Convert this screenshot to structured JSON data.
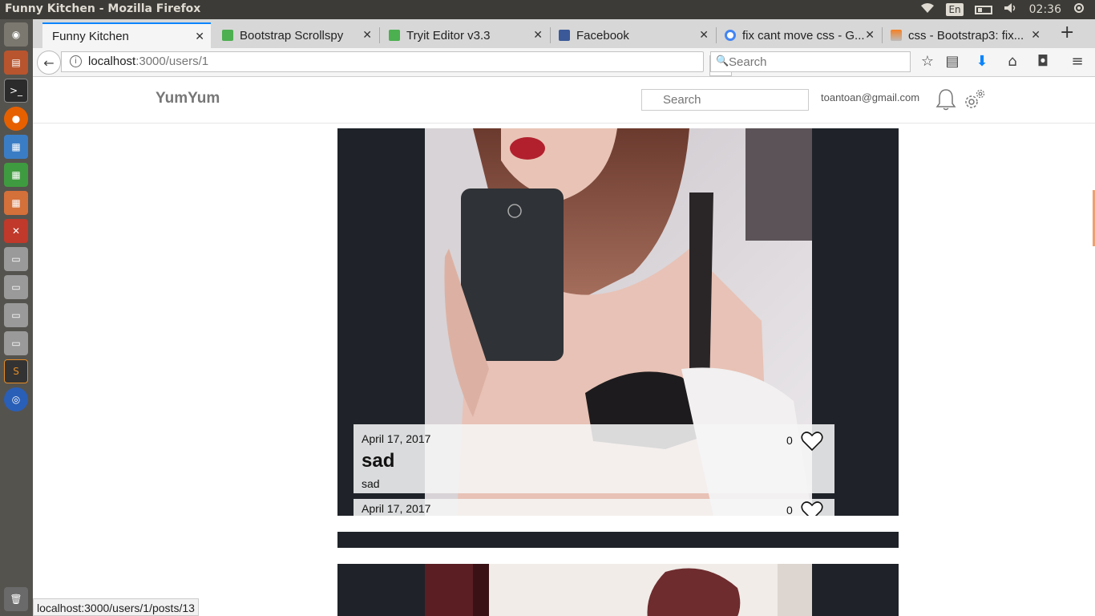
{
  "os": {
    "window_title": "Funny Kitchen - Mozilla Firefox",
    "keyboard_layout": "En",
    "clock": "02:36"
  },
  "browser": {
    "tabs": [
      {
        "label": "Funny Kitchen",
        "icon": "none",
        "active": true
      },
      {
        "label": "Bootstrap Scrollspy",
        "icon": "w3-icon",
        "active": false
      },
      {
        "label": "Tryit Editor v3.3",
        "icon": "w3-icon",
        "active": false
      },
      {
        "label": "Facebook",
        "icon": "facebook-icon",
        "active": false
      },
      {
        "label": "fix cant move css - G...",
        "icon": "google-icon",
        "active": false
      },
      {
        "label": "css - Bootstrap3: fix...",
        "icon": "stackoverflow-icon",
        "active": false
      }
    ],
    "url": {
      "host": "localhost",
      "path": ":3000/users/1"
    },
    "search_placeholder": "Search",
    "status_url": "localhost:3000/users/1/posts/13"
  },
  "site": {
    "brand": "YumYum",
    "search_placeholder": "Search",
    "user_email": "toantoan@gmail.com"
  },
  "posts": [
    {
      "date": "April 17, 2017",
      "likes": "0",
      "title": "sad",
      "body": "sad"
    },
    {
      "date": "April 17, 2017",
      "likes": "0"
    }
  ],
  "colors": {
    "card_bg": "#1f2329",
    "overlay_bg": "#f5f5f5",
    "brand_gray": "#777777",
    "tab_accent": "#0a84ff"
  }
}
